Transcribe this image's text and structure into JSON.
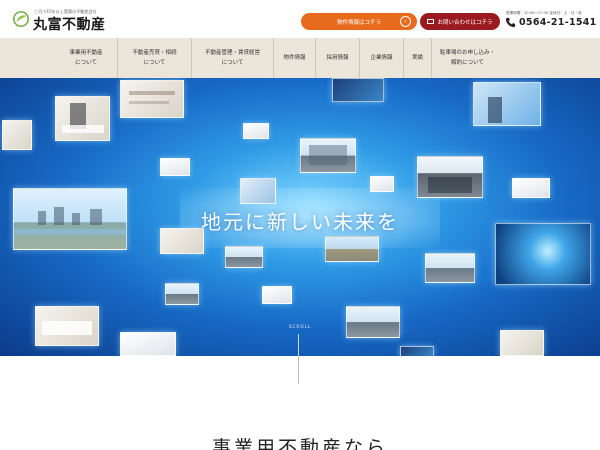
{
  "header": {
    "logo_tagline": "三河で45年以上実績の不動産会社",
    "logo_name": "丸富不動産",
    "property_button": "物件情報はコチラ",
    "contact_button": "お問い合わせはコチラ",
    "hours": "営業時間：10:00〜17:30 定休日：土・日・祝",
    "phone": "0564-21-1541"
  },
  "nav": {
    "items": [
      {
        "line1": "事業用不動産",
        "line2": "について"
      },
      {
        "line1": "不動産売買・相続",
        "line2": "について"
      },
      {
        "line1": "不動産管理・賃貸経営",
        "line2": "について"
      },
      {
        "line1": "物件情報",
        "line2": ""
      },
      {
        "line1": "採用情報",
        "line2": ""
      },
      {
        "line1": "企業情報",
        "line2": ""
      },
      {
        "line1": "実績",
        "line2": ""
      },
      {
        "line1": "駐車場のお申し込み・",
        "line2": "解約について"
      }
    ]
  },
  "hero": {
    "catchphrase": "地元に新しい未来を",
    "scroll_label": "SCROLL"
  },
  "section": {
    "title": "事業用不動産なら"
  },
  "colors": {
    "accent_orange": "#e86a1c",
    "accent_red": "#9b1a1f",
    "nav_bg": "#ebe6d9",
    "hero_blue": "#1769c5"
  }
}
